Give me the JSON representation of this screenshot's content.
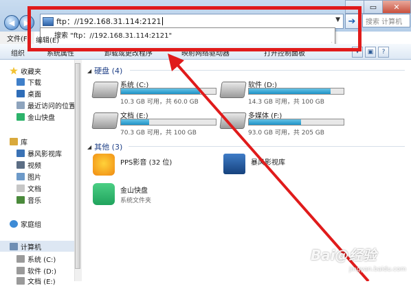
{
  "window": {
    "minimize_glyph": "—",
    "maximize_glyph": "▭",
    "close_glyph": "✕"
  },
  "address": {
    "value": "ftp：//192.168.31.114:2121",
    "suggestion": "搜索 \"ftp：//192.168.31.114:2121\"",
    "search_placeholder": "搜索 计算机"
  },
  "menu": {
    "file": "文件(F)",
    "edit": "编辑(E)"
  },
  "toolbar": {
    "organize": "组织",
    "items": [
      "系统属性",
      "卸载或更改程序",
      "映射网络驱动器",
      "打开控制面板"
    ]
  },
  "sidebar": {
    "favorites": "收藏夹",
    "fav_items": [
      "下载",
      "桌面",
      "最近访问的位置",
      "金山快盘"
    ],
    "library": "库",
    "lib_items": [
      "暴风影视库",
      "视频",
      "图片",
      "文档",
      "音乐"
    ],
    "homegroup": "家庭组",
    "computer": "计算机",
    "comp_items": [
      "系统 (C:)",
      "软件 (D:)",
      "文档 (E:)"
    ]
  },
  "groups": {
    "hdd": "硬盘 (4)",
    "other": "其他 (3)"
  },
  "drives": [
    {
      "name": "系统 (C:)",
      "info": "10.3 GB 可用，共 60.0 GB",
      "used": 0.83
    },
    {
      "name": "软件 (D:)",
      "info": "14.3 GB 可用，共 100 GB",
      "used": 0.86
    },
    {
      "name": "文档 (E:)",
      "info": "70.3 GB 可用，共 100 GB",
      "used": 0.3
    },
    {
      "name": "多媒体 (F:)",
      "info": "93.0 GB 可用，共 205 GB",
      "used": 0.55
    }
  ],
  "others": [
    {
      "name": "PPS影音 (32 位)",
      "sub": ""
    },
    {
      "name": "暴风影视库",
      "sub": ""
    },
    {
      "name": "金山快盘",
      "sub": "系统文件夹"
    }
  ],
  "watermark": {
    "main": "Bai@经验",
    "sub": "jingyan.baidu.com"
  },
  "colors": {
    "annotation": "#e01b1b",
    "accent": "#1e3f86"
  }
}
